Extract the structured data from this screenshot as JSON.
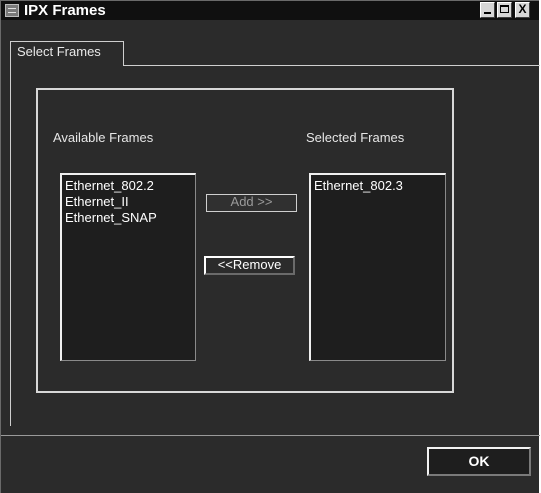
{
  "window": {
    "title": "IPX Frames",
    "controls": [
      "minimize",
      "maximize",
      "close"
    ],
    "close_glyph": "X"
  },
  "tabs": [
    {
      "label": "Select Frames",
      "selected": true
    }
  ],
  "available": {
    "label": "Available Frames",
    "items": [
      "Ethernet_802.2",
      "Ethernet_II",
      "Ethernet_SNAP"
    ]
  },
  "selected": {
    "label": "Selected Frames",
    "items": [
      "Ethernet_802.3"
    ]
  },
  "buttons": {
    "add": "Add >>",
    "remove": "<<Remove",
    "ok": "OK"
  },
  "icons": {
    "app": "network-app-icon",
    "minimize": "minimize-icon",
    "maximize": "maximize-icon",
    "close": "close-icon"
  }
}
